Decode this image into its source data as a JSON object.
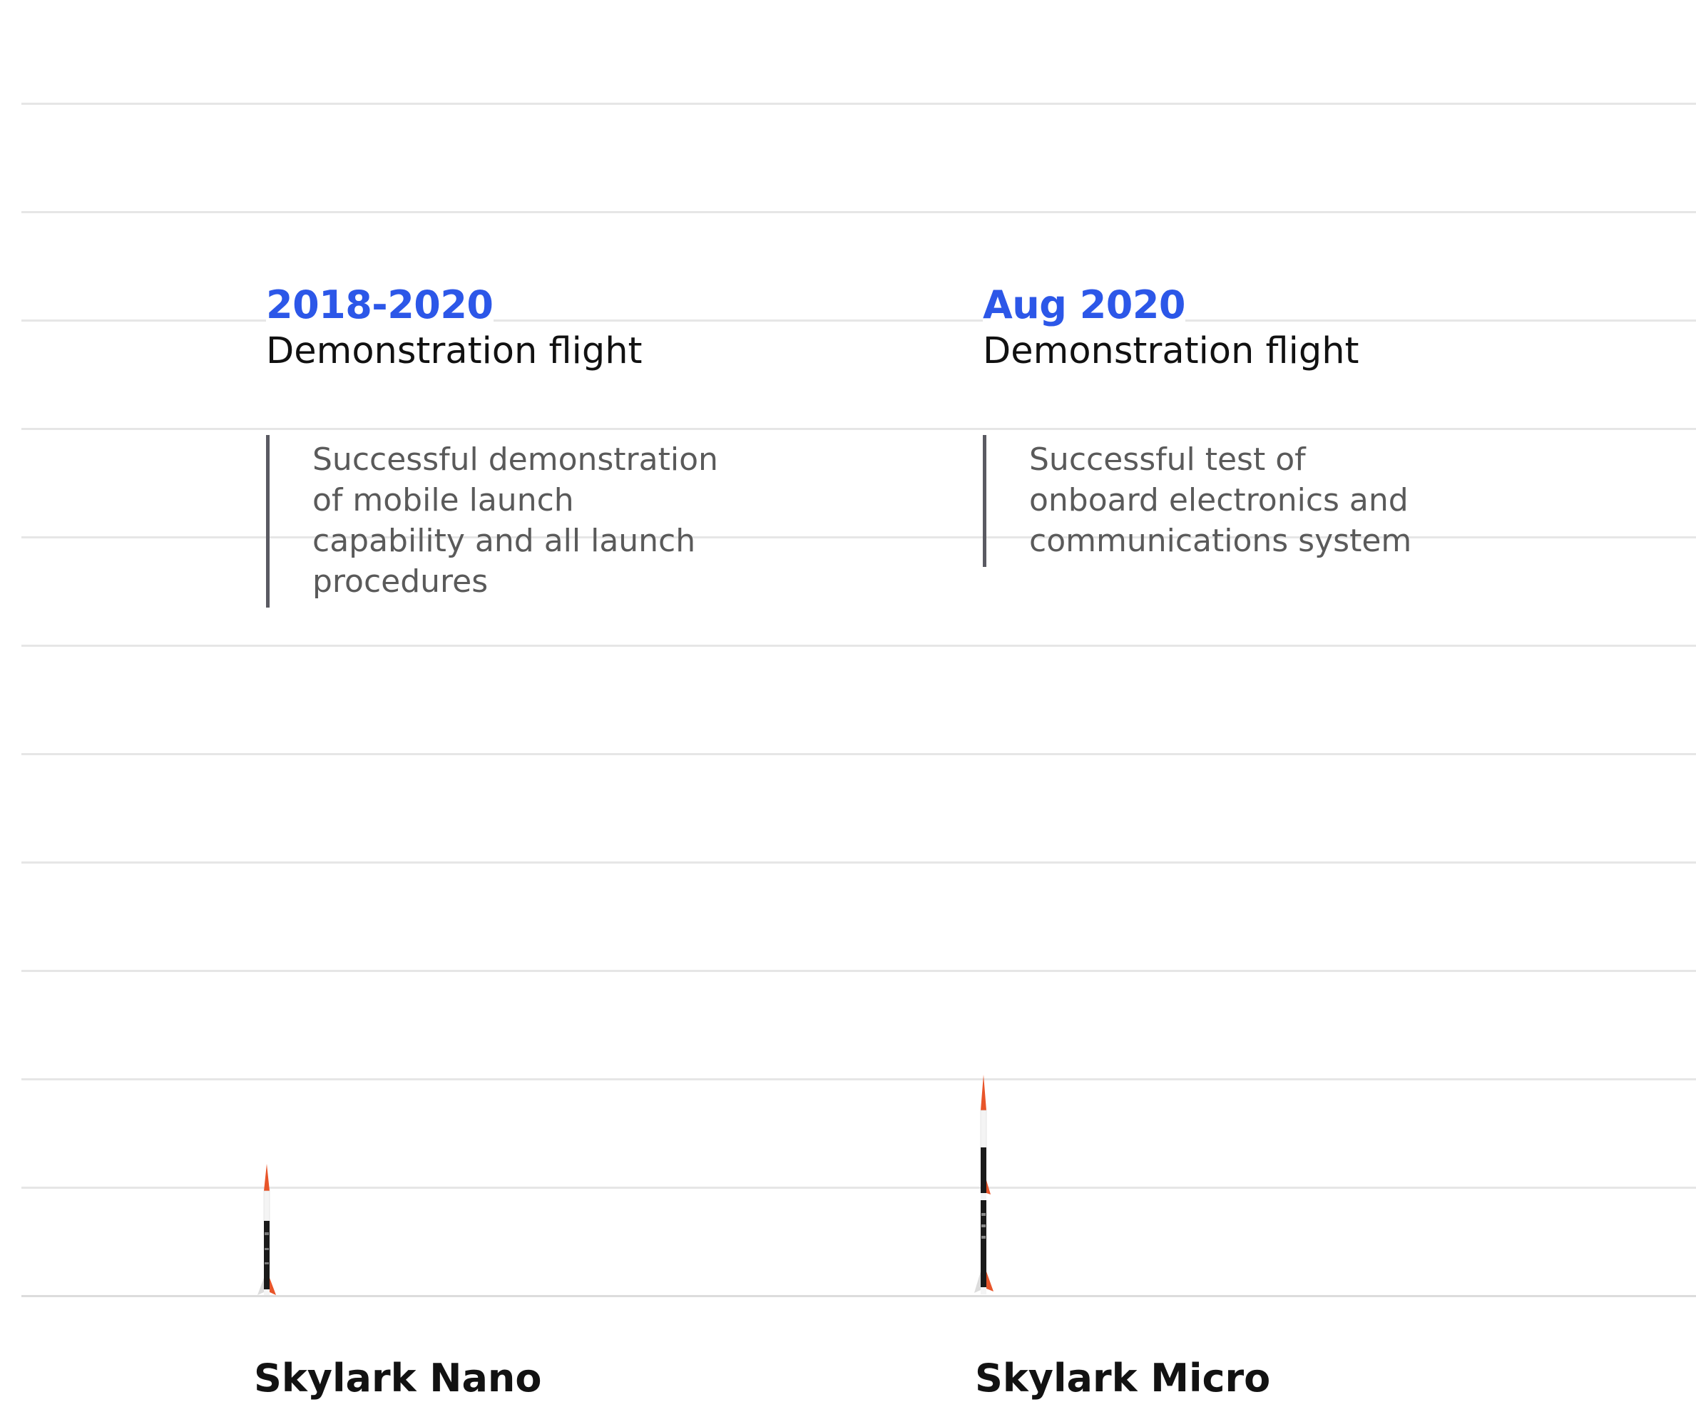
{
  "colors": {
    "accent": "#2c57e8",
    "gridline": "#e6e6e6",
    "quote_bar": "#5a5a62",
    "rocket_orange": "#e8552a",
    "rocket_black": "#1a1a1a"
  },
  "milestones": [
    {
      "date": "2018-2020",
      "title": "Demonstration flight",
      "description_lines": [
        "Successful demonstration",
        "of mobile launch",
        "capability and all launch",
        "procedures"
      ],
      "vehicle": "Skylark Nano"
    },
    {
      "date": "Aug 2020",
      "title": "Demonstration flight",
      "description_lines": [
        "Successful test of",
        "onboard electronics and",
        "communications system"
      ],
      "vehicle": "Skylark Micro"
    }
  ]
}
